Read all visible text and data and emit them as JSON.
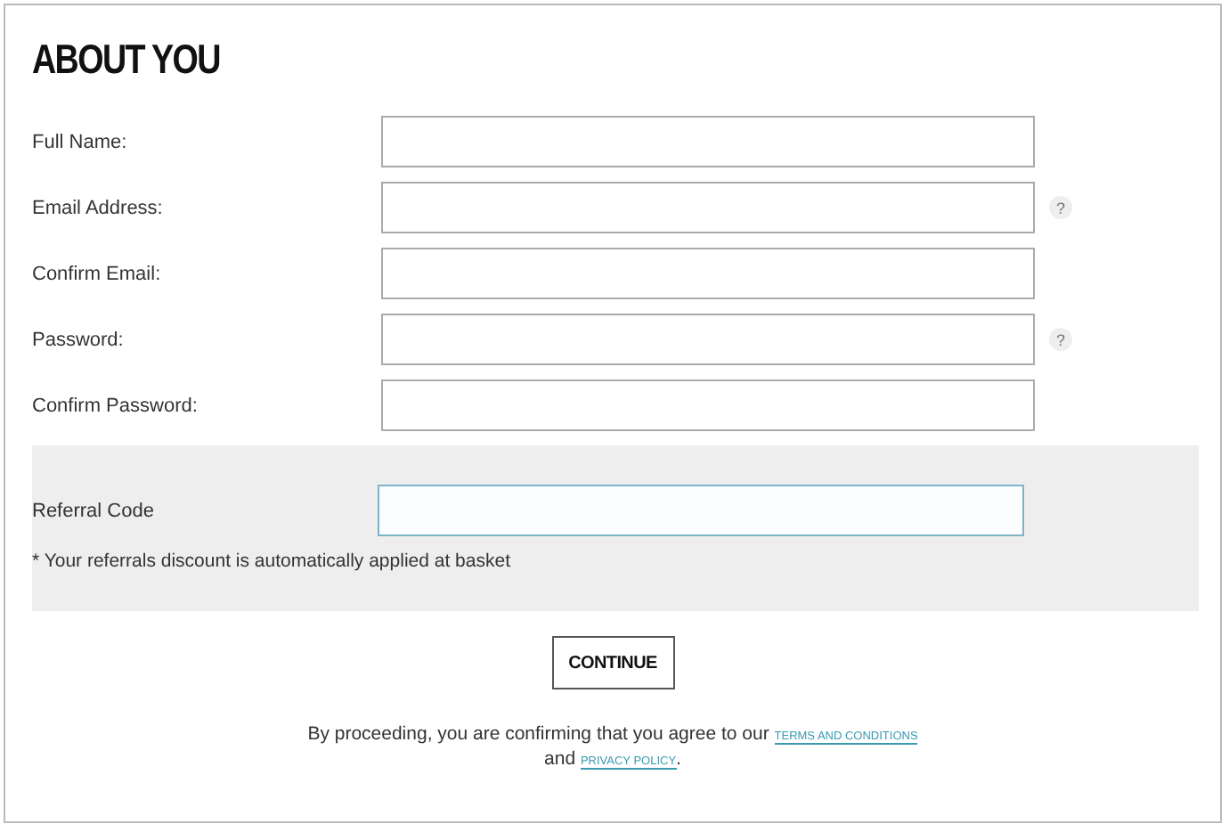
{
  "heading": "ABOUT YOU",
  "fields": [
    {
      "label": "Full Name:"
    },
    {
      "label": "Email Address:",
      "help": "?"
    },
    {
      "label": "Confirm Email:"
    },
    {
      "label": "Password:",
      "help": "?"
    },
    {
      "label": "Confirm Password:"
    }
  ],
  "referral": {
    "label": "Referral Code",
    "focused": true,
    "note": "* Your referrals discount is automatically applied at basket"
  },
  "continue_button": "CONTINUE",
  "consent": {
    "before": "By proceeding, you are confirming that you agree to our",
    "terms_link": "TERMS AND CONDITIONS",
    "middle": "and",
    "privacy_link": "PRIVACY POLICY",
    "after": "."
  }
}
